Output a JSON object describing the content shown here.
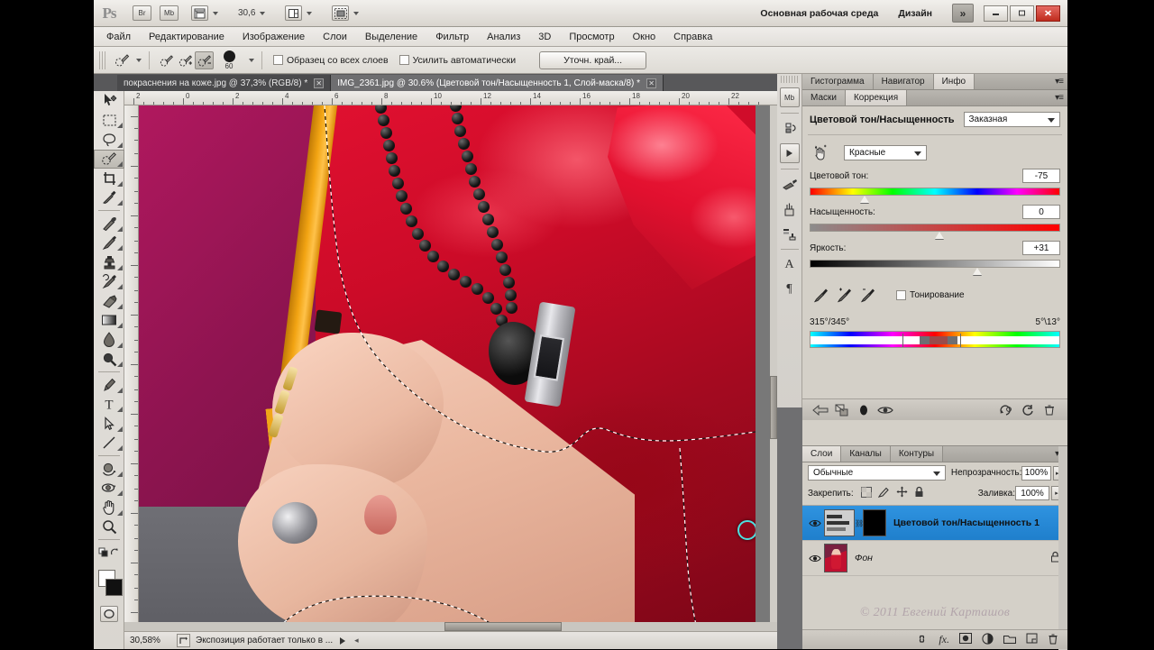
{
  "appbar": {
    "logo": "Ps",
    "bridge_label": "Br",
    "minibridge_label": "Mb",
    "zoom_value": "30,6",
    "workspace_label": "Основная рабочая среда",
    "design_label": "Дизайн",
    "chevron": "»",
    "window_buttons": {
      "minimize": "—",
      "restore": "□",
      "close": "✕"
    }
  },
  "menubar": {
    "items": [
      "Файл",
      "Редактирование",
      "Изображение",
      "Слои",
      "Выделение",
      "Фильтр",
      "Анализ",
      "3D",
      "Просмотр",
      "Окно",
      "Справка"
    ]
  },
  "optionsbar": {
    "brush_size": "60",
    "checkbox_all_layers": "Образец со всех слоев",
    "checkbox_auto_enhance": "Усилить автоматически",
    "refine_edge_button": "Уточн. край..."
  },
  "tabs": [
    {
      "label": "покраснения на коже.jpg @ 37,3% (RGB/8) *",
      "active": false,
      "close": "✕"
    },
    {
      "label": "IMG_2361.jpg @ 30.6% (Цветовой тон/Насыщенность 1, Слой-маска/8) *",
      "active": true,
      "close": "✕"
    }
  ],
  "toolbar": {
    "tools": [
      {
        "name": "move-tool",
        "glyph": "move"
      },
      {
        "name": "marquee-tool",
        "glyph": "marquee"
      },
      {
        "name": "lasso-tool",
        "glyph": "lasso"
      },
      {
        "name": "quick-selection-tool",
        "glyph": "quickselect",
        "selected": true
      },
      {
        "name": "crop-tool",
        "glyph": "crop"
      },
      {
        "name": "eyedropper-tool",
        "glyph": "eyedropper"
      },
      {
        "name": "healing-brush-tool",
        "glyph": "heal"
      },
      {
        "name": "brush-tool",
        "glyph": "brush"
      },
      {
        "name": "clone-stamp-tool",
        "glyph": "stamp"
      },
      {
        "name": "history-brush-tool",
        "glyph": "historybrush"
      },
      {
        "name": "eraser-tool",
        "glyph": "eraser"
      },
      {
        "name": "gradient-tool",
        "glyph": "gradient"
      },
      {
        "name": "blur-tool",
        "glyph": "blur"
      },
      {
        "name": "dodge-tool",
        "glyph": "dodge"
      },
      {
        "name": "pen-tool",
        "glyph": "pen"
      },
      {
        "name": "type-tool",
        "glyph": "type"
      },
      {
        "name": "path-selection-tool",
        "glyph": "pathselect"
      },
      {
        "name": "line-tool",
        "glyph": "line"
      },
      {
        "name": "3d-rotate-tool",
        "glyph": "rotate3d"
      },
      {
        "name": "3d-orbit-tool",
        "glyph": "orbit3d"
      },
      {
        "name": "hand-tool",
        "glyph": "hand"
      },
      {
        "name": "zoom-tool",
        "glyph": "zoom"
      }
    ],
    "foreground_color": "#ffffff",
    "background_color": "#111111"
  },
  "ruler": {
    "horizontal_ticks": [
      "2",
      "0",
      "2",
      "4",
      "6",
      "8",
      "10",
      "12",
      "14",
      "16",
      "18",
      "20",
      "22"
    ],
    "vertical_ticks": [
      "2",
      "0",
      "2",
      "4",
      "6",
      "8",
      "10",
      "12",
      "14",
      "16"
    ]
  },
  "statusbar": {
    "zoom": "30,58%",
    "message": "Экспозиция работает только в ...",
    "arrow": "▶"
  },
  "icondock": {
    "items": [
      {
        "name": "mini-bridge-icon",
        "glyph": "Mb"
      },
      {
        "name": "history-icon",
        "glyph": "↺"
      },
      {
        "name": "actions-icon",
        "glyph": "▶"
      },
      {
        "name": "tool-presets-icon",
        "glyph": "brushpreset"
      },
      {
        "name": "brushes-icon",
        "glyph": "brushjar"
      },
      {
        "name": "clone-source-icon",
        "glyph": "clonesource"
      },
      {
        "name": "character-icon",
        "glyph": "A"
      },
      {
        "name": "paragraph-icon",
        "glyph": "¶"
      }
    ]
  },
  "info_panel": {
    "tabs": [
      "Гистограмма",
      "Навигатор",
      "Инфо"
    ],
    "active_tab": "Инфо"
  },
  "adjustments_panel": {
    "tabs": [
      "Маски",
      "Коррекция"
    ],
    "active_tab": "Коррекция",
    "title": "Цветовой тон/Насыщенность",
    "preset": "Заказная",
    "channel": "Красные",
    "sliders": [
      {
        "name": "hue",
        "label": "Цветовой тон:",
        "value": "-75",
        "thumb_percent": 20
      },
      {
        "name": "saturation",
        "label": "Насыщенность:",
        "value": "0",
        "thumb_percent": 50
      },
      {
        "name": "lightness",
        "label": "Яркость:",
        "value": "+31",
        "thumb_percent": 65
      }
    ],
    "colorize_label": "Тонирование",
    "range_left": "315°/345°",
    "range_right": "5°\\13°",
    "footer_icons": [
      "return-to-list-icon",
      "clip-to-layer-icon",
      "toggle-visibility-icon",
      "preview-eye-icon",
      "reset-previous-icon",
      "reset-icon",
      "delete-icon"
    ]
  },
  "layers_panel": {
    "tabs": [
      "Слои",
      "Каналы",
      "Контуры"
    ],
    "active_tab": "Слои",
    "blend_mode": "Обычные",
    "opacity_label": "Непрозрачность:",
    "opacity_value": "100%",
    "lock_label": "Закрепить:",
    "fill_label": "Заливка:",
    "fill_value": "100%",
    "layers": [
      {
        "name": "Цветовой тон/Насыщенность 1",
        "selected": true,
        "kind": "adjustment",
        "visible": true
      },
      {
        "name": "Фон",
        "selected": false,
        "kind": "background",
        "visible": true,
        "locked": true
      }
    ],
    "footer_icons": [
      "link-icon",
      "fx-icon",
      "mask-icon",
      "adjustment-icon",
      "group-icon",
      "new-layer-icon",
      "delete-layer-icon"
    ]
  },
  "watermark": "© 2011 Евгений Карташов",
  "colors": {
    "accent_selected_layer": "#2f93e0",
    "panel_bg": "#d4d0c8",
    "canvas_bg": "#787878",
    "dress_red": "#cc0b28",
    "background_magenta": "#8e1450"
  }
}
